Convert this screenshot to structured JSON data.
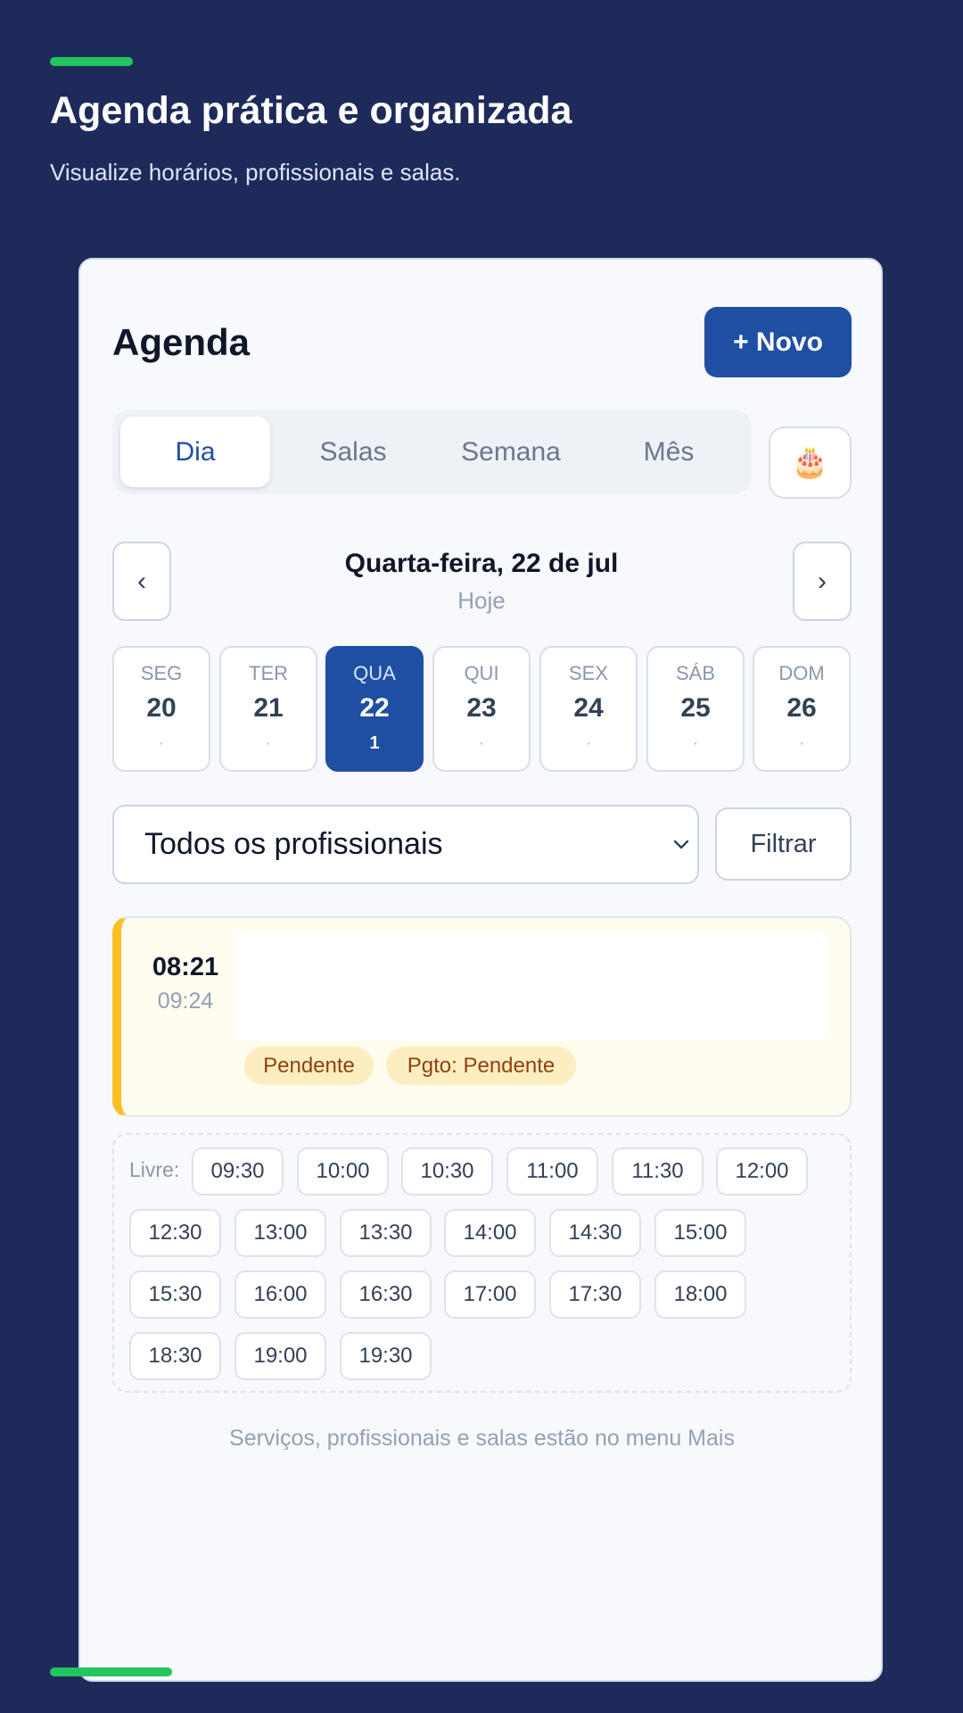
{
  "hero": {
    "title": "Agenda prática e organizada",
    "subtitle": "Visualize horários, profissionais e salas."
  },
  "colors": {
    "background": "#1e2a5a",
    "accent_green": "#22c55e",
    "primary_blue": "#1f4fa3",
    "pending_yellow": "#fbbf24"
  },
  "header": {
    "title": "Agenda",
    "new_button_label": "+ Novo"
  },
  "view_tabs": {
    "selected": "Dia",
    "items": [
      {
        "label": "Dia"
      },
      {
        "label": "Salas"
      },
      {
        "label": "Semana"
      },
      {
        "label": "Mês"
      }
    ]
  },
  "birthday_button": {
    "icon": "birthday-cake-icon",
    "glyph": "🎂"
  },
  "date_nav": {
    "prev_label": "‹",
    "next_label": "›",
    "title": "Quarta-feira, 22 de jul",
    "subtitle": "Hoje"
  },
  "week_days": {
    "selected_index": 2,
    "items": [
      {
        "weekday": "SEG",
        "day": "20",
        "count": "·"
      },
      {
        "weekday": "TER",
        "day": "21",
        "count": "·"
      },
      {
        "weekday": "QUA",
        "day": "22",
        "count": "1"
      },
      {
        "weekday": "QUI",
        "day": "23",
        "count": "·"
      },
      {
        "weekday": "SEX",
        "day": "24",
        "count": "·"
      },
      {
        "weekday": "SÁB",
        "day": "25",
        "count": "·"
      },
      {
        "weekday": "DOM",
        "day": "26",
        "count": "·"
      }
    ]
  },
  "filters": {
    "professional_select_value": "Todos os profissionais",
    "filter_button_label": "Filtrar"
  },
  "appointment": {
    "start": "08:21",
    "end": "09:24",
    "status_badge": "Pendente",
    "payment_badge": "Pgto: Pendente"
  },
  "free_slots": {
    "label": "Livre:",
    "times": [
      "09:30",
      "10:00",
      "10:30",
      "11:00",
      "11:30",
      "12:00",
      "12:30",
      "13:00",
      "13:30",
      "14:00",
      "14:30",
      "15:00",
      "15:30",
      "16:00",
      "16:30",
      "17:00",
      "17:30",
      "18:00",
      "18:30",
      "19:00",
      "19:30"
    ]
  },
  "footer": {
    "hint": "Serviços, profissionais e salas estão no menu Mais"
  }
}
